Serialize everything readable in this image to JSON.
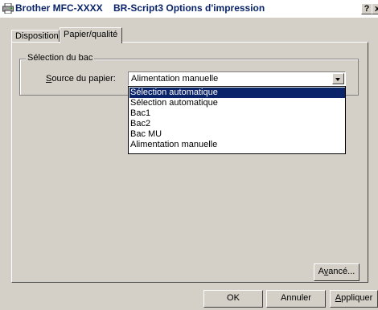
{
  "window": {
    "title": "Brother MFC-XXXX    BR-Script3 Options d'impression",
    "help_label": "?",
    "close_label": "x"
  },
  "tabs": [
    {
      "label": "Disposition",
      "active": false
    },
    {
      "label": "Papier/qualité",
      "active": true
    }
  ],
  "group": {
    "legend": "Sélection du bac",
    "source_label": {
      "underlined": "S",
      "rest": "ource du papier:"
    },
    "source_value": "Alimentation manuelle"
  },
  "dropdown": {
    "options": [
      "Sélection automatique",
      "Sélection automatique",
      "Bac1",
      "Bac2",
      "Bac MU",
      "Alimentation manuelle"
    ],
    "highlighted_index": 0
  },
  "buttons": {
    "advanced": {
      "pre": "A",
      "underlined": "v",
      "post": "ancé..."
    },
    "ok": "OK",
    "cancel": "Annuler",
    "apply": {
      "underlined": "A",
      "post": "ppliquer"
    }
  },
  "colors": {
    "title_text": "#0a246a",
    "selection": "#0a246a",
    "face": "#d4d0c8"
  }
}
